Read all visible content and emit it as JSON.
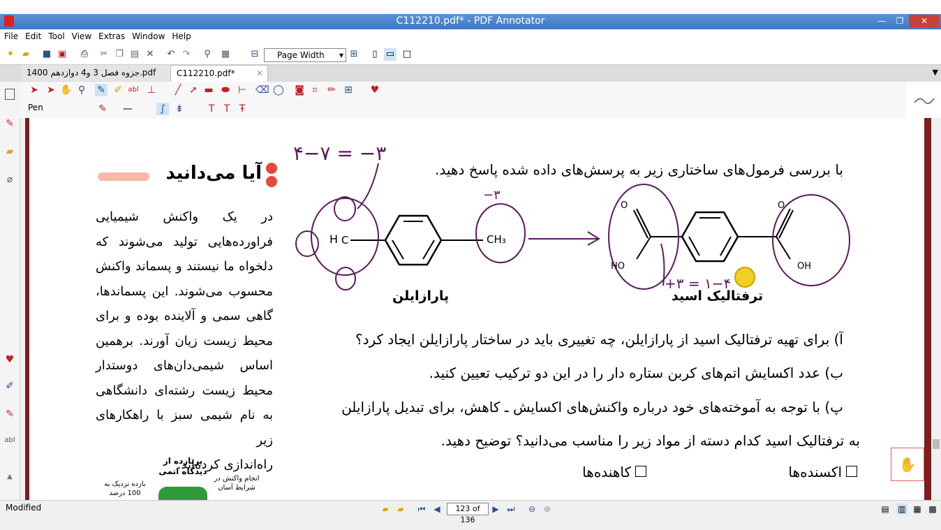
{
  "window": {
    "title": "C112210.pdf* - PDF Annotator",
    "minimize": "—",
    "restore": "❐",
    "close": "✕"
  },
  "menu": [
    "File",
    "Edit",
    "Tool",
    "View",
    "Extras",
    "Window",
    "Help"
  ],
  "toolbar": {
    "zoom_value": "Page Width"
  },
  "tabs": [
    {
      "label": "جزوه فصل 3 و4 دوازدهم 1400.pdf"
    },
    {
      "label": "C112210.pdf*"
    }
  ],
  "annotation_toolbar": {
    "tool_label": "Pen"
  },
  "page": {
    "sidebar_heading": "آیا می‌دانید",
    "sidebar_text": [
      "در یک واکنش شیمیایی",
      "فراورده‌هایی تولید می‌شوند که",
      "دلخواه ما نیستند و پسماند واکنش",
      "محسوب می‌شوند. این پسماندها،",
      "گاهی سمی و آلاینده بوده و برای",
      "محیط زیست زیان آورند. برهمین",
      "اساس شیمی‌دان‌های دوستدار",
      "محیط زیست رشته‌ای دانشگاهی",
      "به نام شیمی سبز با راهکارهای زیر",
      "راه‌اندازی کرده‌اند."
    ],
    "figure_labels": [
      "پربازده از دیدگاه اتمی",
      "انجام واکنش در شرایط آسان",
      "بازده نزدیک به 100 درصد"
    ],
    "question_intro": "با بررسی فرمول‌های ساختاری زیر به پرسش‌های داده شده پاسخ دهید.",
    "paraxylene_label": "پارازایلن",
    "terephthalic_label": "ترفتالیک اسید",
    "chem": {
      "ch3": "CH₃",
      "c": "C",
      "h": "H",
      "o": "O",
      "ho": "HO",
      "oh": "OH"
    },
    "handwriting": {
      "top_left": "۴−۷ = −۳",
      "ch3_mark": "−۳",
      "acid_mark": "+۳ = ۱−۴"
    },
    "q_a": "آ) برای تهیه ترفتالیک اسید از پارازایلن، چه تغییری باید در ساختار پارازایلن ایجاد کرد؟",
    "q_b": "ب) عدد اکسایش اتم‌های کربن ستاره دار را در این دو ترکیب تعیین کنید.",
    "q_c1": "پ) با توجه به آموخته‌های خود درباره واکنش‌های اکسایش ـ کاهش، برای تبدیل پارازایلن",
    "q_c2": "به ترفتالیک اسید کدام دسته از مواد زیر را مناسب می‌دانید؟ توضیح دهید.",
    "option1": "اکسنده‌ها",
    "option2": "کاهنده‌ها"
  },
  "status": {
    "state": "Modified",
    "page_indicator": "123 of 136"
  },
  "colors": {
    "titlebar": "#3e78c2",
    "page_border": "#7b1e1e",
    "ink": "#5a1a5a",
    "heading_accent": "#e8473a"
  }
}
